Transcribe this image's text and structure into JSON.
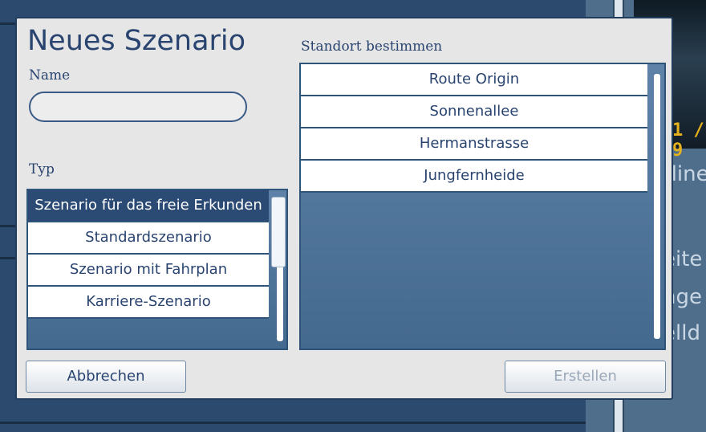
{
  "background": {
    "photo_sign": "1 / 9",
    "side_texts": [
      "rline",
      "eite",
      "nge",
      "elld"
    ]
  },
  "dialog": {
    "title": "Neues Szenario",
    "name_label": "Name",
    "name_value": "",
    "type_label": "Typ",
    "types": [
      {
        "label": "Szenario für das freie Erkunden",
        "selected": true
      },
      {
        "label": "Standardszenario",
        "selected": false
      },
      {
        "label": "Szenario mit Fahrplan",
        "selected": false
      },
      {
        "label": "Karriere-Szenario",
        "selected": false
      }
    ],
    "location_label": "Standort bestimmen",
    "locations": [
      {
        "label": "Route Origin"
      },
      {
        "label": "Sonnenallee"
      },
      {
        "label": "Hermanstrasse"
      },
      {
        "label": "Jungfernheide"
      }
    ],
    "cancel_label": "Abbrechen",
    "create_label": "Erstellen",
    "create_enabled": false
  },
  "colors": {
    "accent": "#2a4470",
    "selected_bg": "#2b4a74",
    "list_bg": "#4a7099",
    "dialog_bg": "#e6e6e6"
  }
}
